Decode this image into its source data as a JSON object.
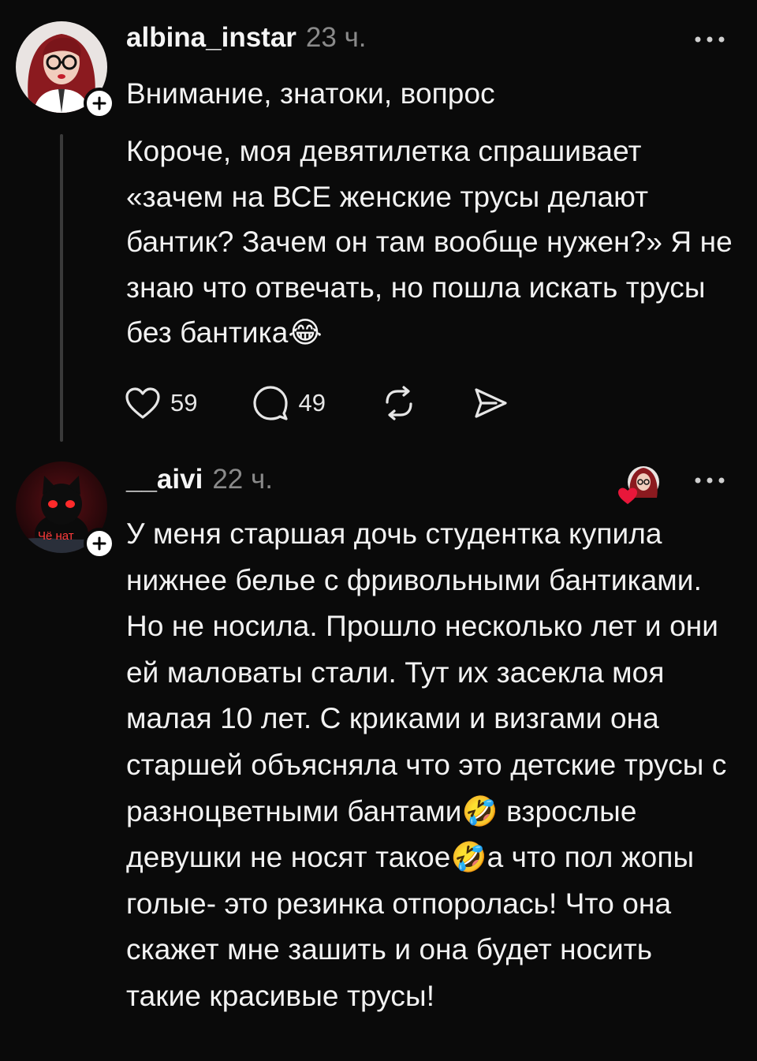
{
  "posts": [
    {
      "username": "albina_instar",
      "timestamp": "23 ч.",
      "title": "Внимание, знатоки, вопрос",
      "text": "Короче, моя девятилетка спрашивает «зачем на ВСЕ женские трусы делают бантик? Зачем он там вообще нужен?» Я не знаю что отвечать, но пошла искать трусы без бантика😂",
      "likes": "59",
      "comments": "49"
    },
    {
      "username": "__aivi",
      "timestamp": "22 ч.",
      "avatar_caption": "Чё нат",
      "text": "У меня старшая дочь студентка купила нижнее белье с фривольными бантиками. Но не носила. Прошло несколько лет и они ей маловаты стали. Тут их засекла моя малая 10 лет. С криками и визгами она старшей объясняла что это детские трусы с разноцветными бантами🤣 взрослые девушки не носят такое🤣а что пол жопы голые- это резинка отпоролась! Что она скажет мне зашить и она будет носить такие красивые трусы!"
    }
  ],
  "icons": {
    "more": "more-icon",
    "follow": "plus-icon",
    "like": "heart-icon",
    "comment": "comment-icon",
    "repost": "repost-icon",
    "share": "send-icon",
    "liked_by_author": "heart-badge-icon"
  },
  "colors": {
    "background": "#0a0a0a",
    "text": "#f2f2f2",
    "muted": "#8a8a8a",
    "thread_line": "#3a3a3a",
    "heart_badge": "#e8173a"
  }
}
